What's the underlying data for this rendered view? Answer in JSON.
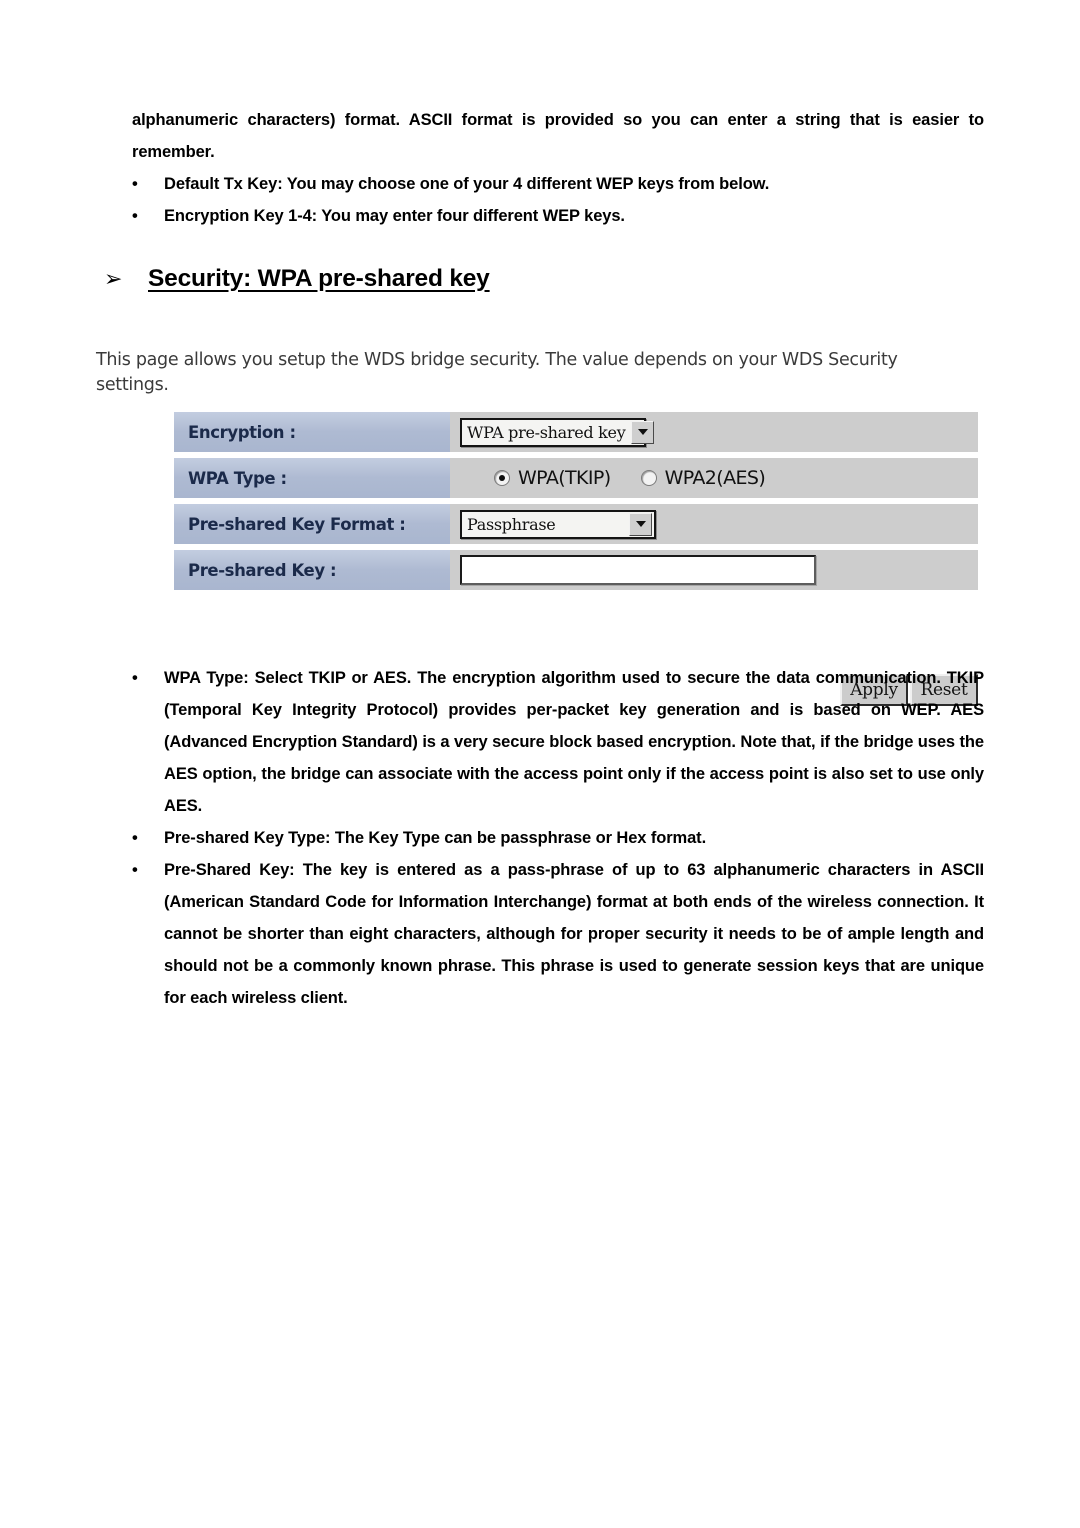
{
  "document": {
    "intro": {
      "continuation_paragraph": "alphanumeric characters) format. ASCII format is provided so you can enter a string that is easier to remember.",
      "bullets": [
        "Default Tx Key: You may choose one of your 4 different WEP keys from below.",
        "Encryption Key 1-4: You may enter four different WEP keys."
      ]
    },
    "heading": {
      "arrow_glyph": "➢",
      "text": "Security: WPA pre-shared key"
    },
    "notes": {
      "bullet_glyph": "•",
      "items": [
        "WPA Type: Select TKIP or AES. The encryption algorithm used to secure the data communication. TKIP (Temporal Key Integrity Protocol) provides per-packet key generation and is based on WEP. AES (Advanced Encryption Standard) is a very secure block based encryption. Note that, if the bridge uses the AES option, the bridge can associate with the access point only if the access point is also set to use only AES.",
        "Pre-shared Key Type: The Key Type can be passphrase or Hex format.",
        "Pre-Shared Key: The key is entered as a pass-phrase of up to 63 alphanumeric characters in ASCII (American Standard Code for Information Interchange) format at both ends of the wireless connection. It cannot be shorter than eight characters, although for proper security it needs to be of ample length and should not be a commonly known phrase. This phrase is used to generate session keys that are unique for each wireless client."
      ]
    }
  },
  "screenshot": {
    "description": "This page allows you setup the WDS bridge security. The value depends on your WDS Security settings.",
    "rows": {
      "encryption": {
        "label": "Encryption :",
        "value": "WPA pre-shared key",
        "control": "dropdown"
      },
      "wpa_type": {
        "label": "WPA Type :",
        "options": [
          {
            "label": "WPA(TKIP)",
            "selected": true
          },
          {
            "label": "WPA2(AES)",
            "selected": false
          }
        ]
      },
      "key_format": {
        "label": "Pre-shared Key Format :",
        "value": "Passphrase",
        "control": "dropdown"
      },
      "pre_shared_key": {
        "label": "Pre-shared Key :",
        "value": "",
        "placeholder": ""
      }
    },
    "buttons": {
      "apply": "Apply",
      "reset": "Reset"
    },
    "colors": {
      "label_cell": "#aebad2",
      "value_cell": "#cdcdcd",
      "label_text": "#1b2a4a",
      "button_face": "#cccccc"
    }
  }
}
